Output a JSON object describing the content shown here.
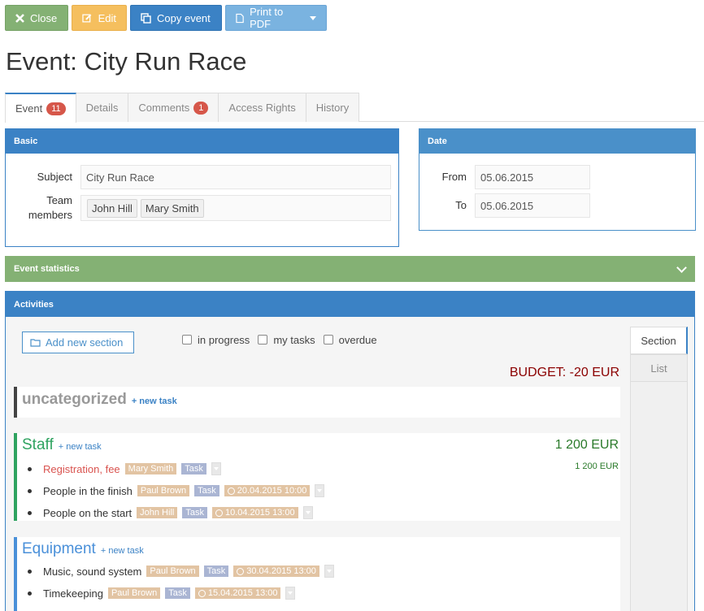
{
  "toolbar": {
    "close_label": "Close",
    "edit_label": "Edit",
    "copy_label": "Copy event",
    "print_label": "Print to PDF"
  },
  "page": {
    "title": "Event: City Run Race"
  },
  "tabs": [
    {
      "label": "Event",
      "badge": "11",
      "active": true
    },
    {
      "label": "Details"
    },
    {
      "label": "Comments",
      "badge": "1"
    },
    {
      "label": "Access Rights"
    },
    {
      "label": "History"
    }
  ],
  "basic": {
    "header": "Basic",
    "subject_label": "Subject",
    "subject_value": "City Run Race",
    "team_label": "Team members",
    "team_members": [
      "John Hill",
      "Mary Smith"
    ]
  },
  "date": {
    "header": "Date",
    "from_label": "From",
    "from_value": "05.06.2015",
    "to_label": "To",
    "to_value": "05.06.2015"
  },
  "stats": {
    "header": "Event statistics"
  },
  "activities": {
    "header": "Activities",
    "add_section_label": "Add new section",
    "filters": [
      "in progress",
      "my tasks",
      "overdue"
    ],
    "view_tabs": [
      "Section",
      "List"
    ],
    "budget": "BUDGET: -20 EUR",
    "new_task_label": "+ new task",
    "sections": [
      {
        "title": "uncategorized"
      },
      {
        "title": "Staff",
        "total": "1 200 EUR",
        "tasks": [
          {
            "name": "Registration, fee",
            "person": "Mary Smith",
            "type": "Task",
            "amount": "1 200 EUR"
          },
          {
            "name": "People in the finish",
            "person": "Paul Brown",
            "type": "Task",
            "date": "20.04.2015 10:00"
          },
          {
            "name": "People on the start",
            "person": "John Hill",
            "type": "Task",
            "date": "10.04.2015 13:00"
          }
        ]
      },
      {
        "title": "Equipment",
        "tasks": [
          {
            "name": "Music, sound system",
            "person": "Paul Brown",
            "type": "Task",
            "date": "30.04.2015 13:00"
          },
          {
            "name": "Timekeeping",
            "person": "Paul Brown",
            "type": "Task",
            "date": "15.04.2015 13:00"
          }
        ]
      }
    ]
  },
  "colors": {
    "primary": "#3b82c5",
    "success": "#84b174",
    "warning": "#f5bf5e",
    "danger": "#d9534f"
  },
  "icons": {
    "close": "x-icon",
    "edit": "pencil-icon",
    "copy": "copy-icon",
    "print": "pdf-file-icon",
    "stats_toggle": "chevron-down-icon",
    "add_section": "folder-icon",
    "date_tag": "clock-icon"
  }
}
